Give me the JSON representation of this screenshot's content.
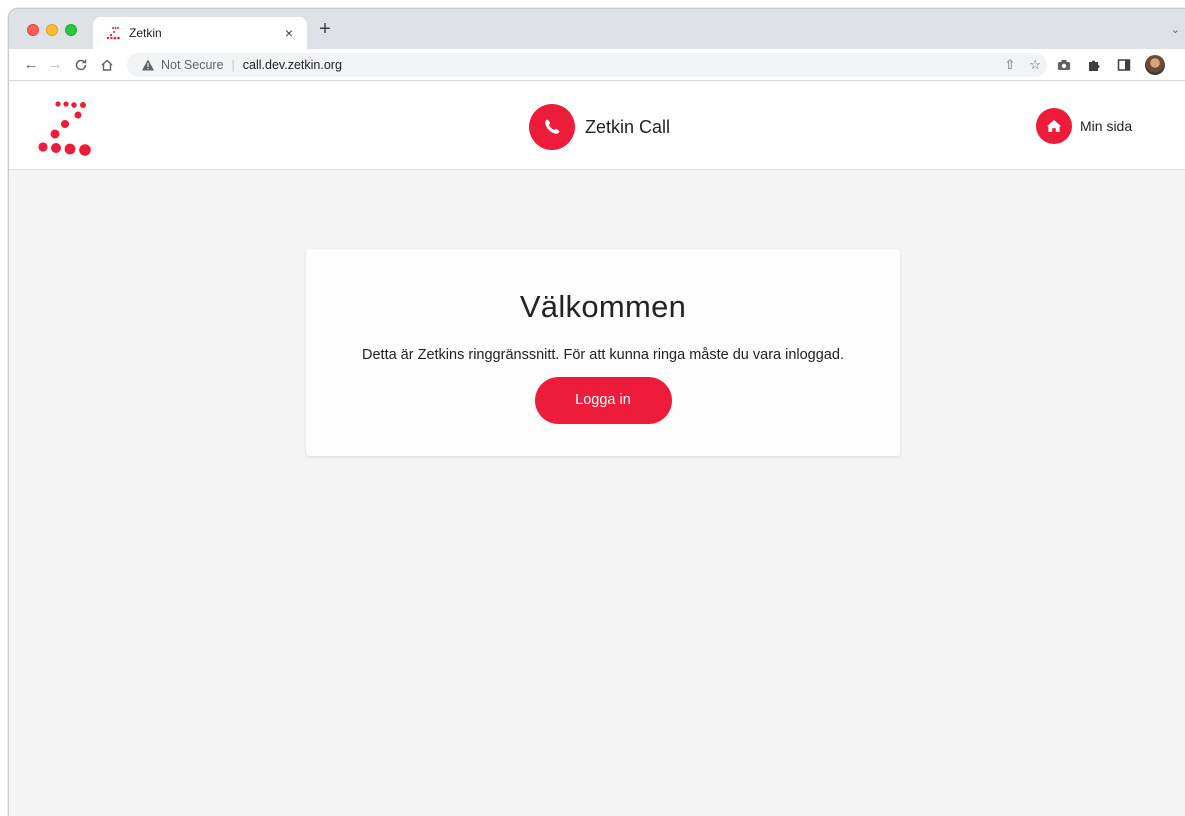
{
  "browser": {
    "tab": {
      "title": "Zetkin",
      "close_glyph": "×",
      "favicon": "zetkin-logo-icon"
    },
    "new_tab_glyph": "+",
    "overflow_glyph": "⌄",
    "nav": {
      "back": "←",
      "forward": "→",
      "reload": "C",
      "home": "⌂"
    },
    "address": {
      "security_label": "Not Secure",
      "separator": "|",
      "url": "call.dev.zetkin.org"
    },
    "omnibox_actions": {
      "share": "⇧",
      "bookmark": "☆"
    },
    "menu_glyph": "⋮"
  },
  "header": {
    "app_title": "Zetkin Call",
    "my_page_label": "Min sida"
  },
  "card": {
    "title": "Välkommen",
    "text": "Detta är Zetkins ringgränssnitt. För att kunna ringa måste du vara inloggad.",
    "login_label": "Logga in"
  },
  "colors": {
    "brand_red": "#ed1c3b",
    "page_bg": "#f4f4f4",
    "card_bg": "#fdfdfd"
  }
}
